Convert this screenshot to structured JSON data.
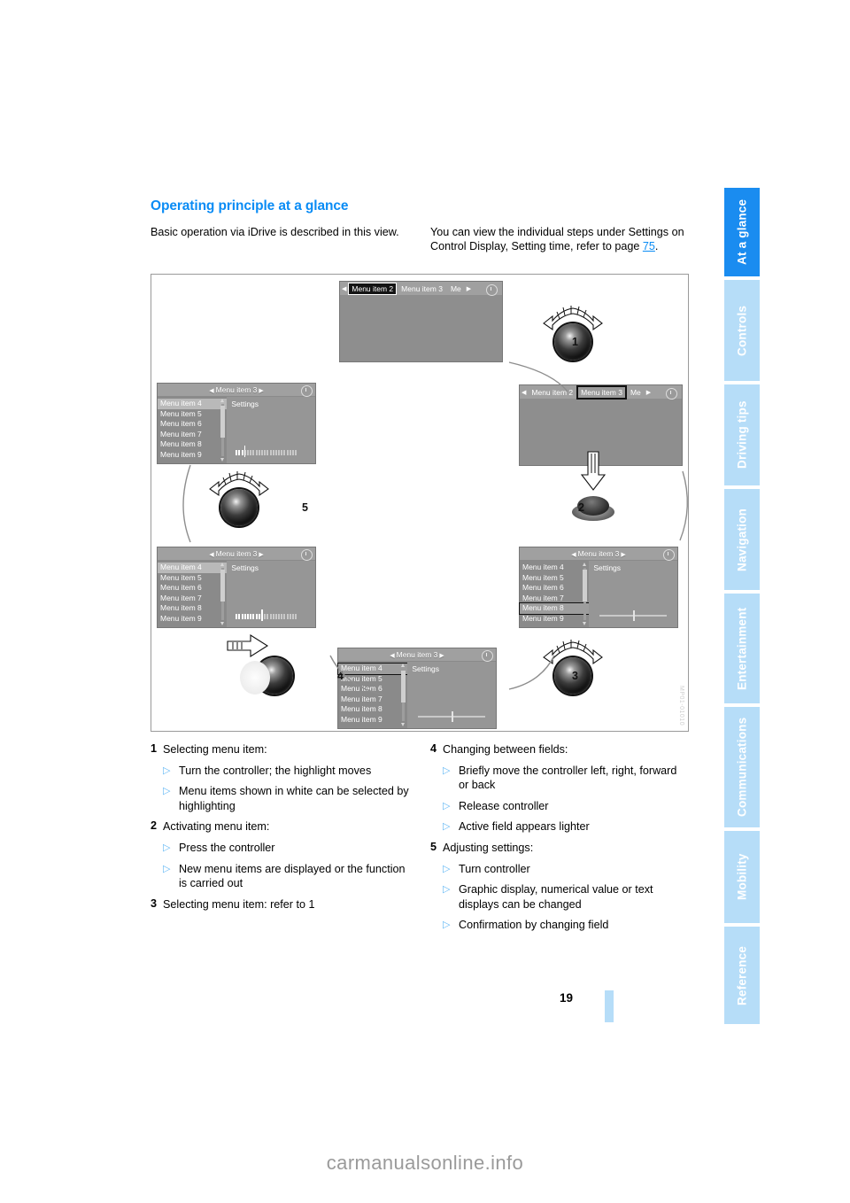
{
  "document": {
    "page_number": "19",
    "watermark": "carmanualsonline.info",
    "figure_code": "MP01-01010"
  },
  "heading": "Operating principle at a glance",
  "intro": {
    "left": "Basic operation via iDrive is described in this view.",
    "right_before_link": "You can view the individual steps under Settings on Control Display, Setting time, refer to page ",
    "right_link": "75",
    "right_after_link": "."
  },
  "tabs": [
    {
      "label": "At a glance",
      "active": true
    },
    {
      "label": "Controls",
      "active": false
    },
    {
      "label": "Driving tips",
      "active": false
    },
    {
      "label": "Navigation",
      "active": false
    },
    {
      "label": "Entertainment",
      "active": false
    },
    {
      "label": "Communications",
      "active": false
    },
    {
      "label": "Mobility",
      "active": false
    },
    {
      "label": "Reference",
      "active": false
    }
  ],
  "figure": {
    "screens": {
      "top": {
        "type": "tabstrip",
        "tabs": [
          "Menu item 2",
          "Menu item 3",
          "Me"
        ],
        "selected": "Menu item 2",
        "selection_style": "inverted"
      },
      "right_upper": {
        "type": "tabstrip",
        "tabs": [
          "Menu item 2",
          "Menu item 3",
          "Me"
        ],
        "selected": "Menu item 3",
        "selection_style": "boxed"
      },
      "left_upper": {
        "type": "list",
        "title": "Menu item 3",
        "items": [
          "Menu item 4",
          "Menu item 5",
          "Menu item 6",
          "Menu item 7",
          "Menu item 8",
          "Menu item 9"
        ],
        "highlighted": "Menu item 4",
        "pane_title": "Settings",
        "slider": {
          "style": "bars",
          "filled": 3,
          "total": 22
        }
      },
      "left_lower": {
        "type": "list",
        "title": "Menu item 3",
        "items": [
          "Menu item 4",
          "Menu item 5",
          "Menu item 6",
          "Menu item 7",
          "Menu item 8",
          "Menu item 9"
        ],
        "highlighted": "Menu item 4",
        "pane_title": "Settings",
        "slider": {
          "style": "bars",
          "filled": 9,
          "total": 22
        }
      },
      "right_lower": {
        "type": "list",
        "title": "Menu item 3",
        "items": [
          "Menu item 4",
          "Menu item 5",
          "Menu item 6",
          "Menu item 7",
          "Menu item 8",
          "Menu item 9"
        ],
        "boxed": "Menu item 8",
        "pane_title": "Settings",
        "slider": {
          "style": "line",
          "position": 50
        }
      },
      "bottom": {
        "type": "list",
        "title": "Menu item 3",
        "items": [
          "Menu item 4",
          "Menu item 5",
          "Menu item 6",
          "Menu item 7",
          "Menu item 8",
          "Menu item 9"
        ],
        "boxed": "Menu item 4",
        "pane_title": "Settings",
        "slider": {
          "style": "line",
          "position": 50
        }
      }
    },
    "knobs": [
      {
        "number": "1",
        "action": "turn"
      },
      {
        "number": "2",
        "action": "press"
      },
      {
        "number": "3",
        "action": "turn"
      },
      {
        "number": "4",
        "action": "move-lateral"
      },
      {
        "number": "5",
        "action": "turn"
      }
    ]
  },
  "steps": {
    "left": [
      {
        "number": "1",
        "title": "Selecting menu item:",
        "bullets": [
          "Turn the controller; the highlight moves",
          "Menu items shown in white can be selected by highlighting"
        ]
      },
      {
        "number": "2",
        "title": "Activating menu item:",
        "bullets": [
          "Press the controller",
          "New menu items are displayed or the function is carried out"
        ]
      },
      {
        "number": "3",
        "title": "Selecting menu item: refer to 1",
        "bullets": []
      }
    ],
    "right": [
      {
        "number": "4",
        "title": "Changing between fields:",
        "bullets": [
          "Briefly move the controller left, right, forward or back",
          "Release controller",
          "Active field appears lighter"
        ]
      },
      {
        "number": "5",
        "title": "Adjusting settings:",
        "bullets": [
          "Turn controller",
          "Graphic display, numerical value or text displays can be changed",
          "Confirmation by changing field"
        ]
      }
    ]
  },
  "colors": {
    "accent": "#0a8cf5",
    "tab_inactive": "#b6ddf8",
    "tab_active": "#1a8cf0",
    "bullet": "#63b8f5"
  }
}
